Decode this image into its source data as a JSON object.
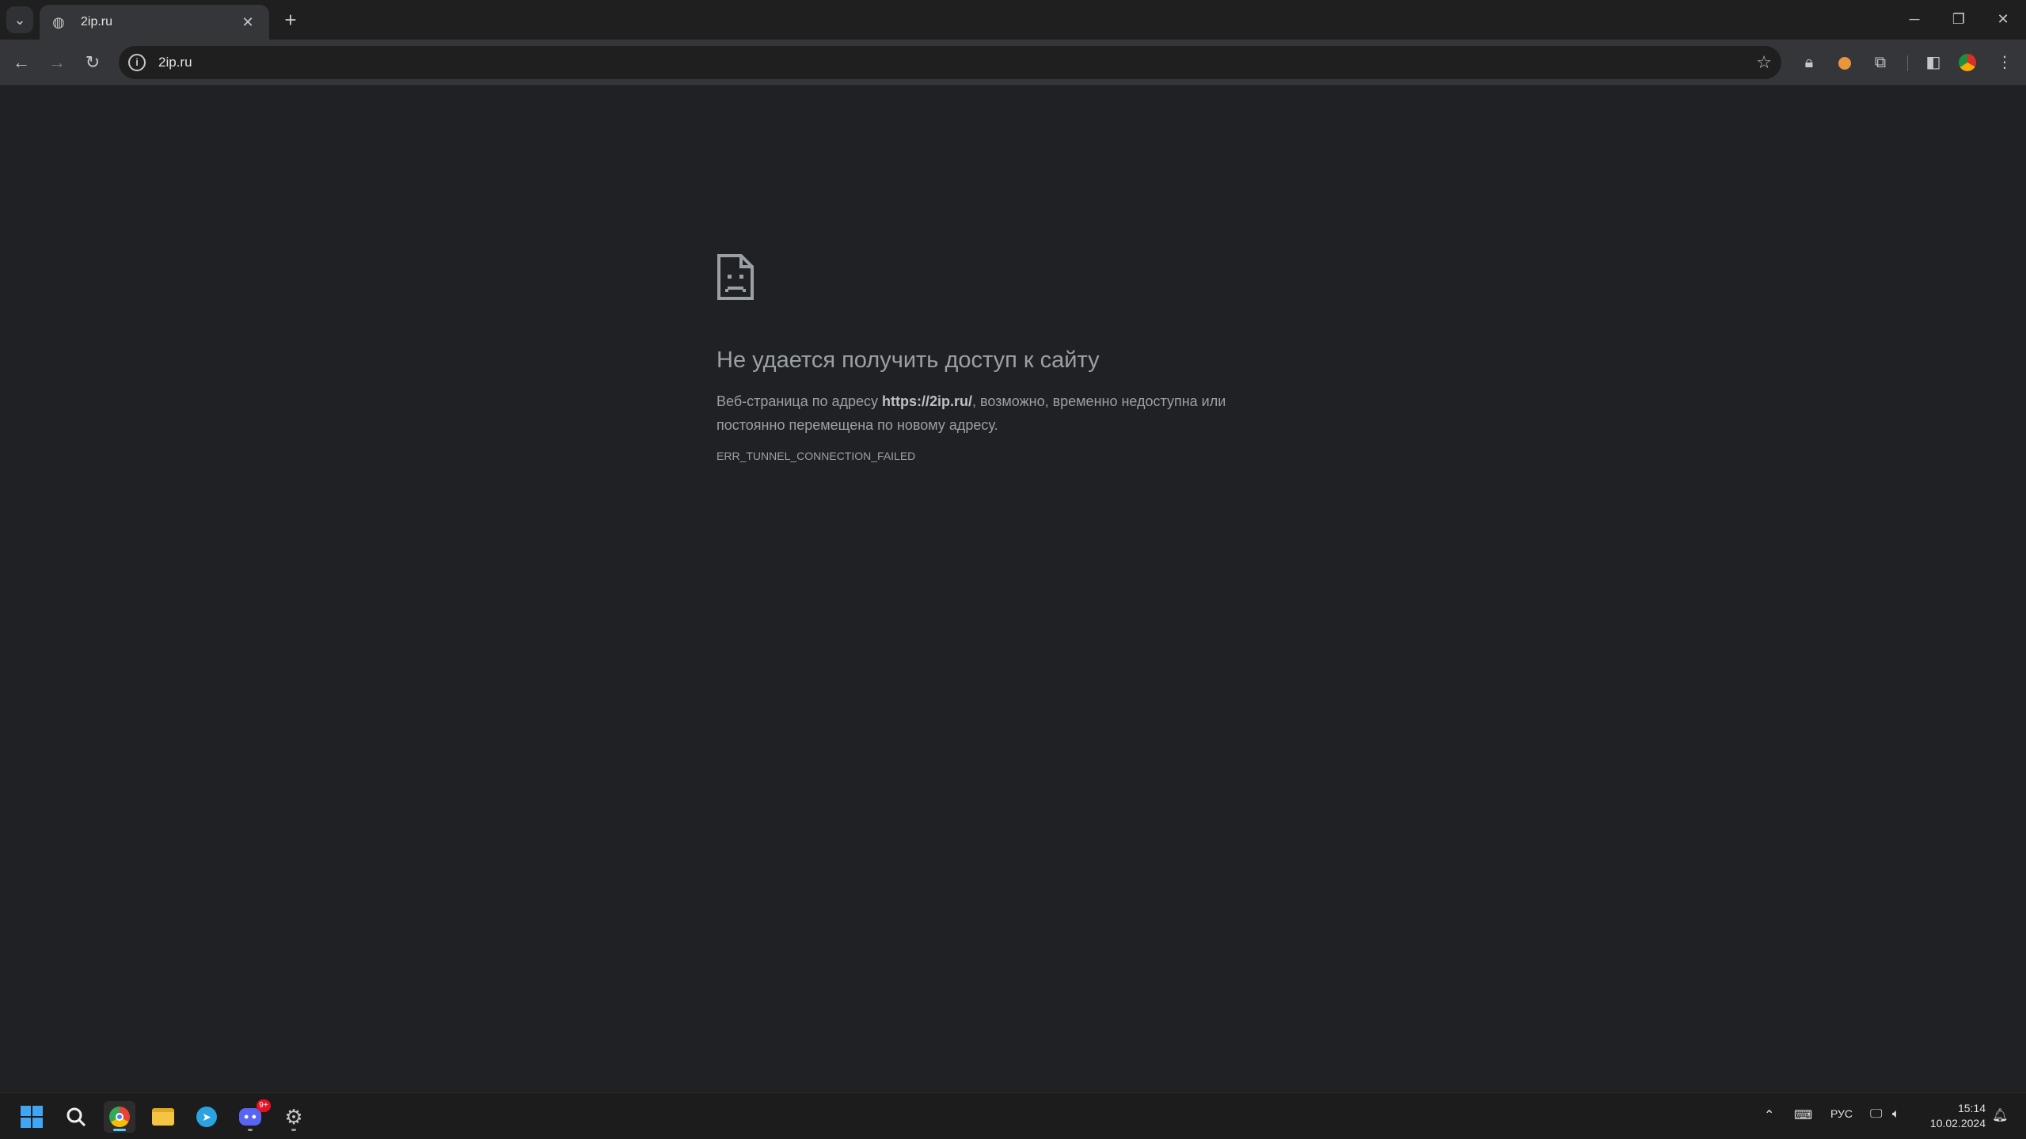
{
  "browser": {
    "tab": {
      "title": "2ip.ru"
    },
    "new_tab_label": "+",
    "omnibox": {
      "url": "2ip.ru"
    }
  },
  "error_page": {
    "title": "Не удается получить доступ к сайту",
    "desc_prefix": "Веб-страница по адресу ",
    "desc_url": "https://2ip.ru/",
    "desc_suffix": ", возможно, временно недоступна или постоянно перемещена по новому адресу.",
    "code": "ERR_TUNNEL_CONNECTION_FAILED"
  },
  "taskbar": {
    "apps": [
      "start",
      "search",
      "chrome",
      "file-explorer",
      "telegram",
      "discord",
      "settings"
    ],
    "discord_badge": "9+",
    "language": "РУС",
    "time": "15:14",
    "date": "10.02.2024"
  },
  "colors": {
    "page_bg": "#202124",
    "tabstrip_bg": "#1f1f1f",
    "toolbar_bg": "#35363a",
    "text_muted": "#9aa0a6",
    "taskbar_bg": "#1c1c1c",
    "accent": "#60cdff"
  }
}
